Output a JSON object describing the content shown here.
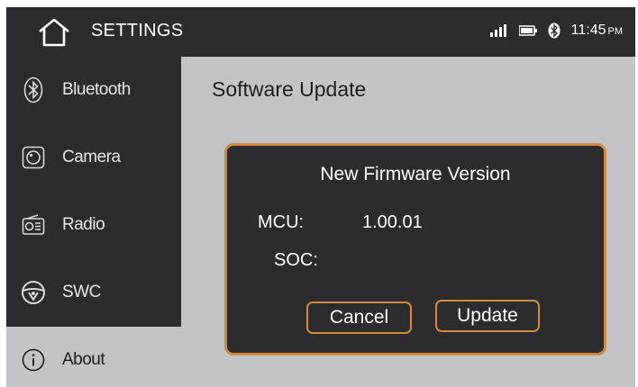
{
  "header": {
    "title": "SETTINGS",
    "clock": {
      "time": "11:45",
      "ampm": "PM"
    },
    "status_icons": [
      "signal-icon",
      "battery-icon",
      "bluetooth-icon"
    ]
  },
  "sidebar": {
    "items": [
      {
        "label": "Bluetooth",
        "icon": "bluetooth-icon",
        "active": false
      },
      {
        "label": "Camera",
        "icon": "camera-icon",
        "active": false
      },
      {
        "label": "Radio",
        "icon": "radio-icon",
        "active": false
      },
      {
        "label": "SWC",
        "icon": "steering-wheel-icon",
        "active": false
      },
      {
        "label": "About",
        "icon": "info-icon",
        "active": true
      }
    ]
  },
  "main": {
    "title": "Software Update",
    "dialog": {
      "title": "New Firmware Version",
      "mcu_label": "MCU:",
      "mcu_value": "1.00.01",
      "soc_label": "SOC:",
      "soc_value": "",
      "cancel_label": "Cancel",
      "update_label": "Update"
    }
  },
  "colors": {
    "dark_panel": "#2c2c2e",
    "content_bg": "#c3c4c8",
    "accent_orange": "#d08a3c"
  }
}
